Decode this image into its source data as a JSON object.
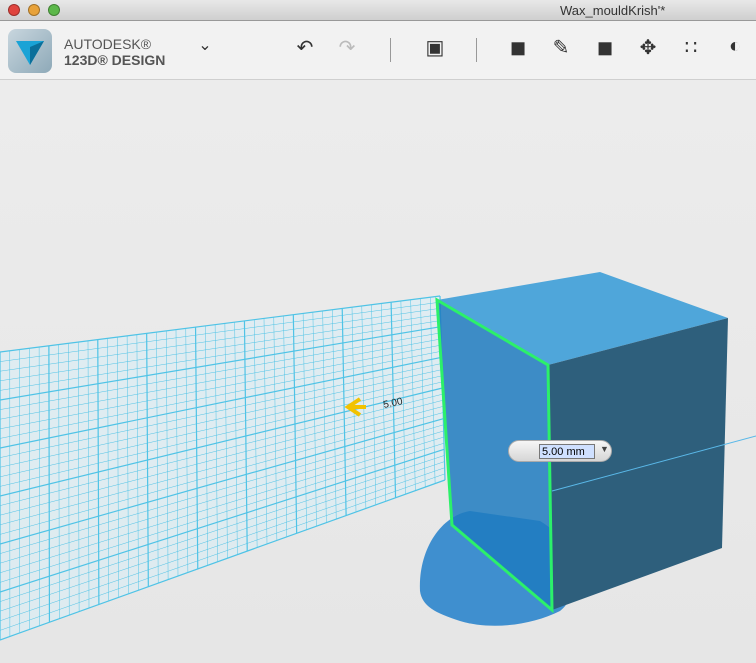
{
  "window": {
    "title": "Wax_mouldKrish'*"
  },
  "brand": {
    "line1": "AUTODESK®",
    "line2": "123D® DESIGN"
  },
  "toolbar": {
    "icons": [
      "undo-icon",
      "redo-icon",
      "transform-icon",
      "primitives-icon",
      "sketch-icon",
      "construct-icon",
      "modify-icon",
      "pattern-icon",
      "combine-icon"
    ]
  },
  "viewport": {
    "dimension_value": "5.00 mm",
    "arrow_label": "5.00"
  },
  "colors": {
    "grid": "#4fc3e6",
    "box_top": "#4fa6da",
    "box_side": "#2e5f7c",
    "face": "#1e7bbf",
    "edge": "#2cf06a"
  }
}
